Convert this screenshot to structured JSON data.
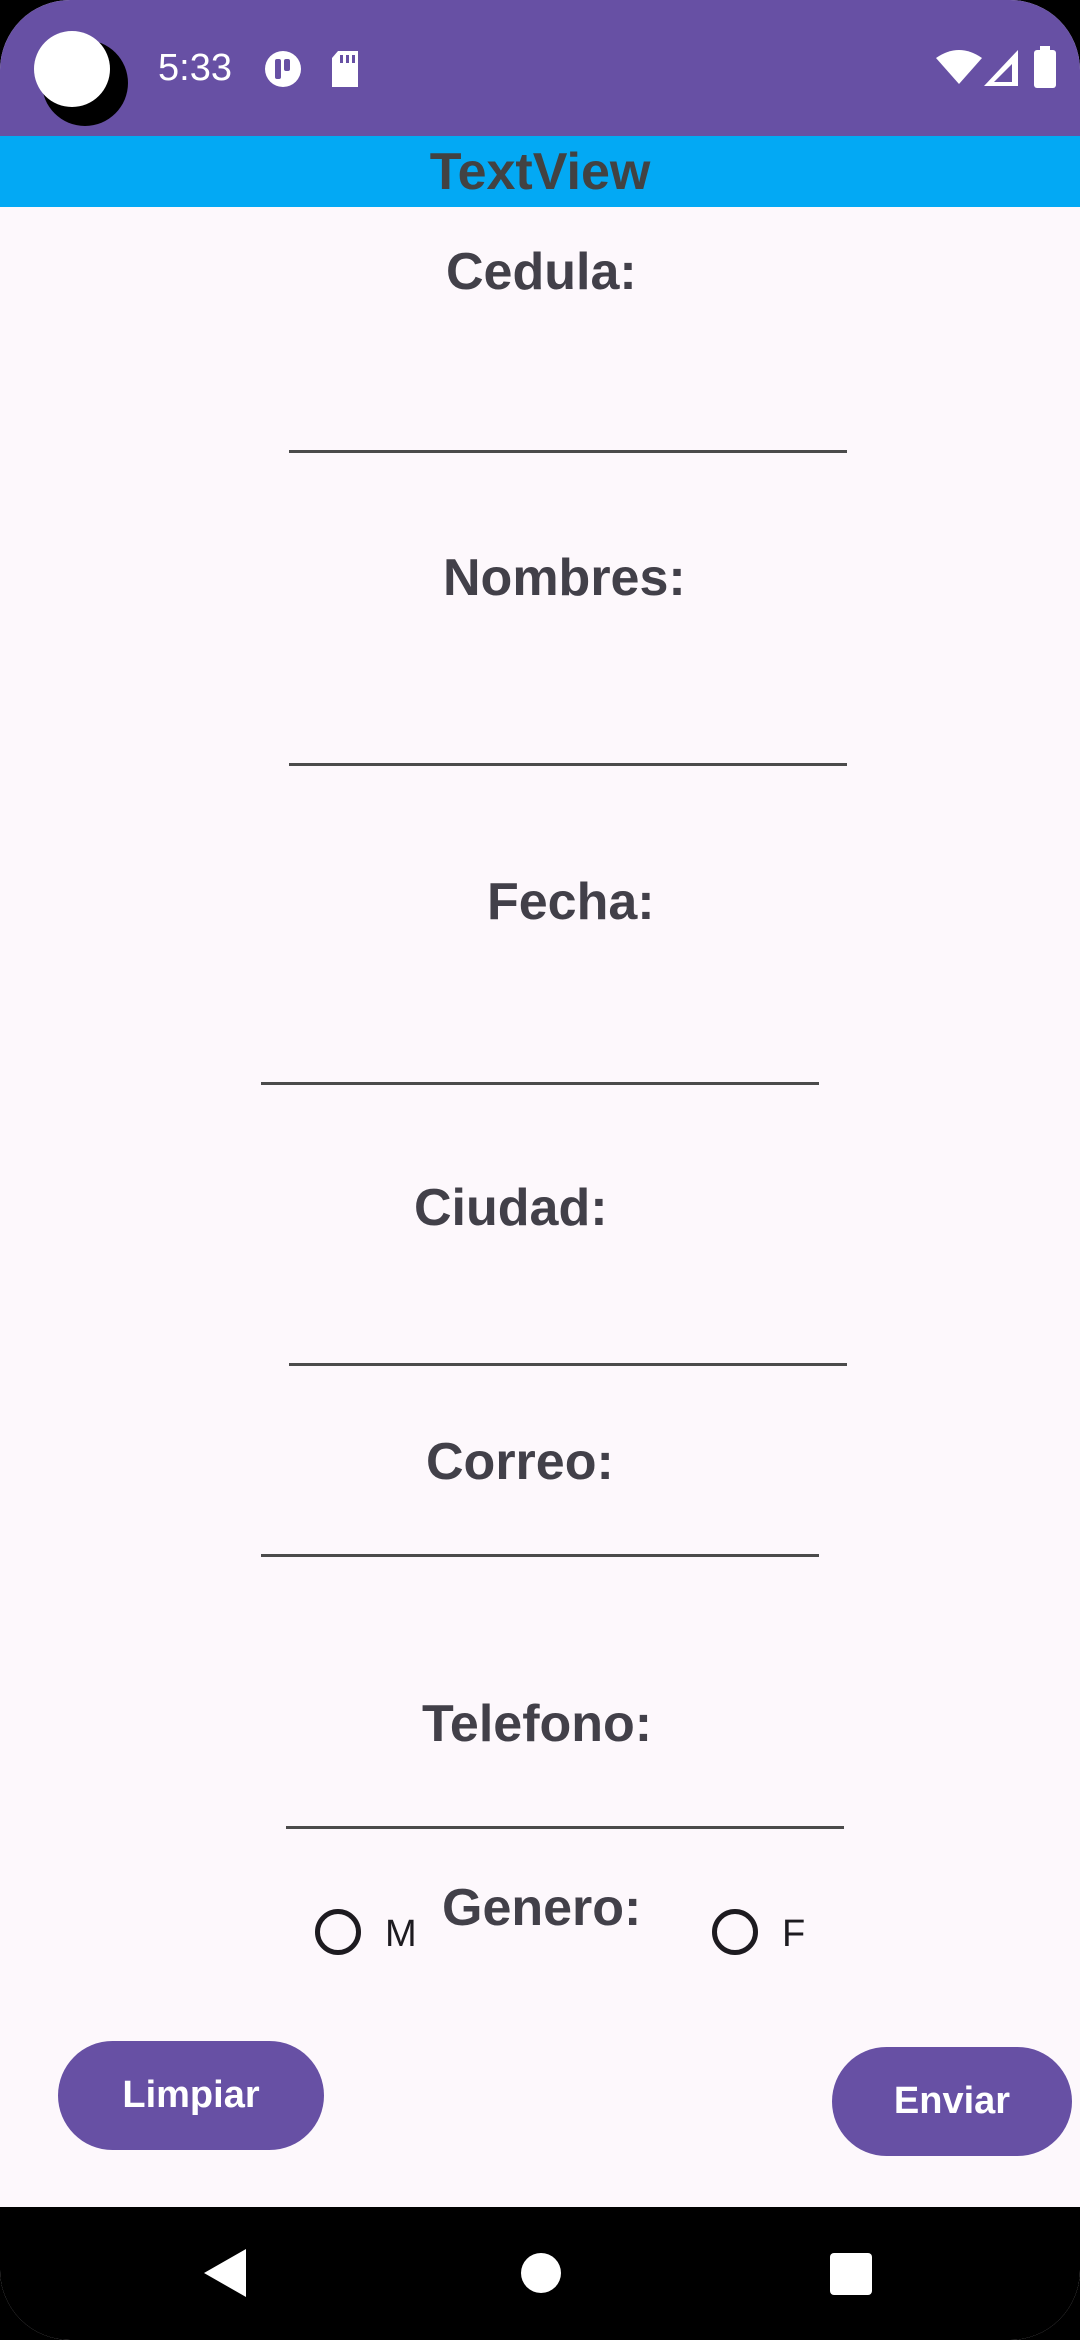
{
  "status_bar": {
    "time": "5:33",
    "bg_color": "#6750a4"
  },
  "app_bar": {
    "title": "TextView",
    "bg_color": "#03a9f4"
  },
  "form": {
    "cedula_label": "Cedula:",
    "cedula_value": "",
    "nombres_label": "Nombres:",
    "nombres_value": "",
    "fecha_label": "Fecha:",
    "fecha_value": "",
    "ciudad_label": "Ciudad:",
    "ciudad_value": "",
    "correo_label": "Correo:",
    "correo_value": "",
    "telefono_label": "Telefono:",
    "telefono_value": "",
    "genero_label": "Genero:",
    "gender_options": [
      "M",
      "F"
    ]
  },
  "buttons": {
    "clear_label": "Limpiar",
    "submit_label": "Enviar",
    "color": "#6750a4"
  },
  "icons": {
    "status": [
      "camera-cutout",
      "notification-icon",
      "sd-card-icon",
      "wifi-icon",
      "cell-signal-icon",
      "battery-icon"
    ],
    "nav": [
      "back-icon",
      "home-icon",
      "recents-icon"
    ]
  }
}
